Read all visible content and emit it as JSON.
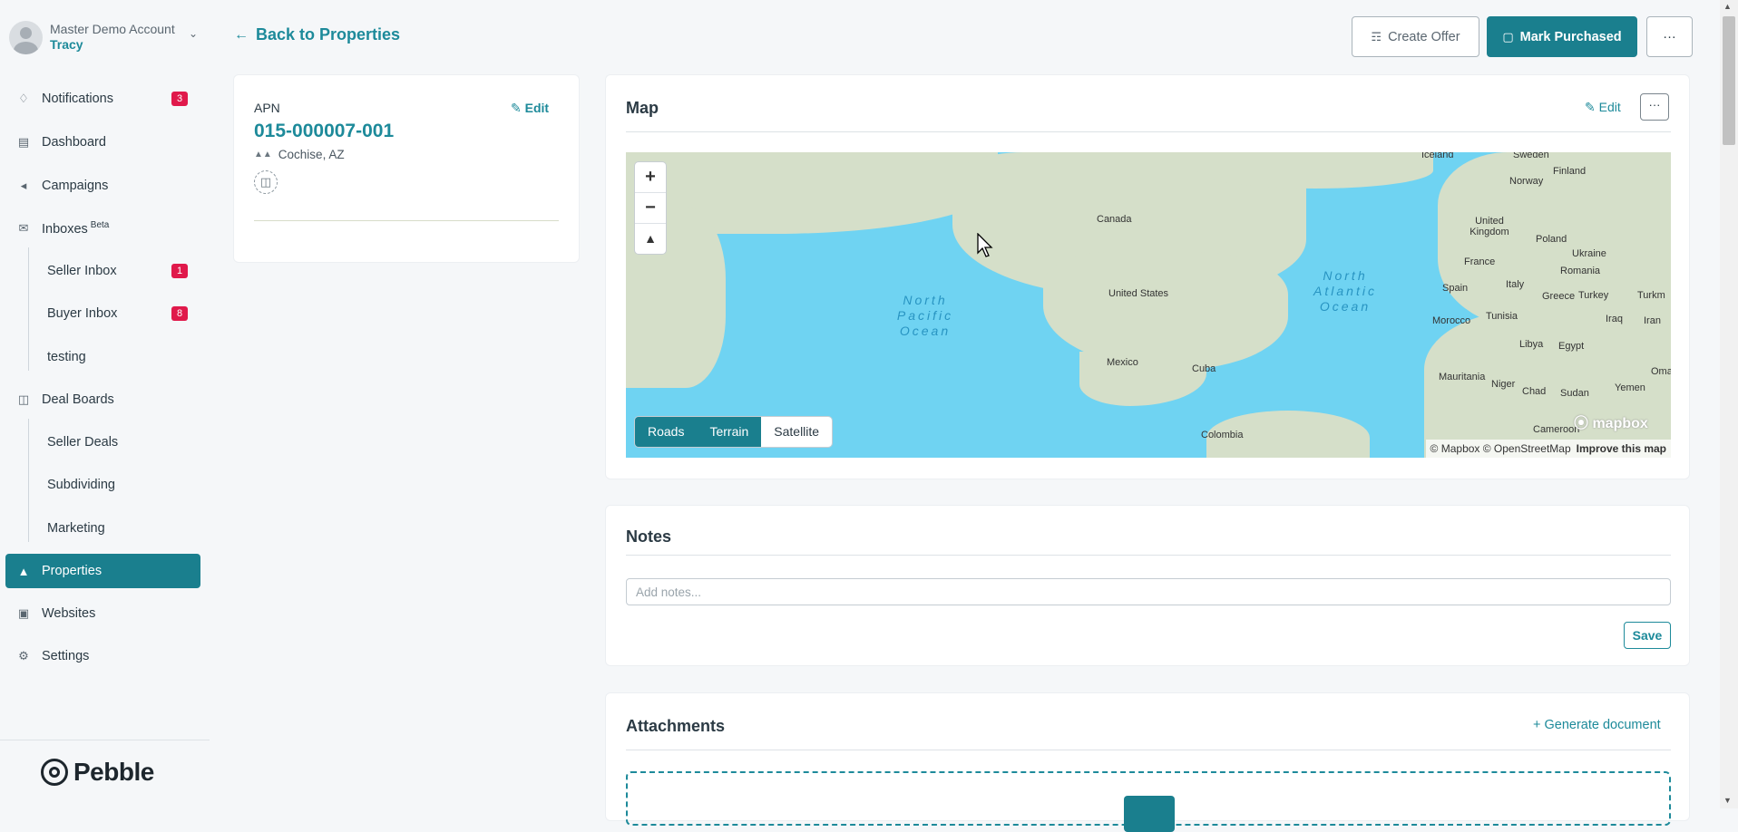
{
  "account": {
    "name": "Master Demo Account",
    "user": "Tracy"
  },
  "nav": {
    "notifications": {
      "label": "Notifications",
      "badge": "3"
    },
    "dashboard": {
      "label": "Dashboard"
    },
    "campaigns": {
      "label": "Campaigns"
    },
    "inboxes": {
      "label": "Inboxes",
      "beta": "Beta"
    },
    "seller_inbox": {
      "label": "Seller Inbox",
      "badge": "1"
    },
    "buyer_inbox": {
      "label": "Buyer Inbox",
      "badge": "8"
    },
    "testing": {
      "label": "testing"
    },
    "deal_boards": {
      "label": "Deal Boards"
    },
    "seller_deals": {
      "label": "Seller Deals"
    },
    "subdividing": {
      "label": "Subdividing"
    },
    "marketing": {
      "label": "Marketing"
    },
    "properties": {
      "label": "Properties"
    },
    "websites": {
      "label": "Websites"
    },
    "settings": {
      "label": "Settings"
    }
  },
  "logo": {
    "text": "Pebble"
  },
  "header": {
    "back_label": "Back to Properties",
    "create_offer": "Create Offer",
    "mark_purchased": "Mark Purchased",
    "more": "···"
  },
  "apn": {
    "label": "APN",
    "value": "015-000007-001",
    "location": "Cochise, AZ",
    "edit": "Edit"
  },
  "map_card": {
    "title": "Map",
    "edit": "Edit",
    "more": "···",
    "zoom_in": "+",
    "zoom_out": "−",
    "compass": "▲",
    "styles": {
      "roads": "Roads",
      "terrain": "Terrain",
      "satellite": "Satellite"
    },
    "labels": {
      "iceland": "Iceland",
      "sweden": "Sweden",
      "finland": "Finland",
      "norway": "Norway",
      "canada": "Canada",
      "uk": "United Kingdom",
      "poland": "Poland",
      "ukraine": "Ukraine",
      "france": "France",
      "romania": "Romania",
      "spain": "Spain",
      "italy": "Italy",
      "greece": "Greece",
      "turkey": "Turkm",
      "turkey_full": "Turkey",
      "usa": "United States",
      "morocco": "Morocco",
      "tunisia": "Tunisia",
      "iraq": "Iraq",
      "iran": "Iran",
      "libya": "Libya",
      "egypt": "Egypt",
      "mexico": "Mexico",
      "cuba": "Cuba",
      "mauritania": "Mauritania",
      "niger": "Niger",
      "chad": "Chad",
      "sudan": "Sudan",
      "yemen": "Yemen",
      "oman": "Oma",
      "cameroon": "Cameroon",
      "colombia": "Colombia",
      "north_pacific": "North Pacific Ocean",
      "north_atlantic": "North Atlantic Ocean"
    },
    "mapbox": "mapbox",
    "attribution": "© Mapbox © OpenStreetMap",
    "improve": "Improve this map"
  },
  "notes": {
    "title": "Notes",
    "placeholder": "Add notes...",
    "save": "Save"
  },
  "attachments": {
    "title": "Attachments",
    "generate": "+ Generate document"
  }
}
